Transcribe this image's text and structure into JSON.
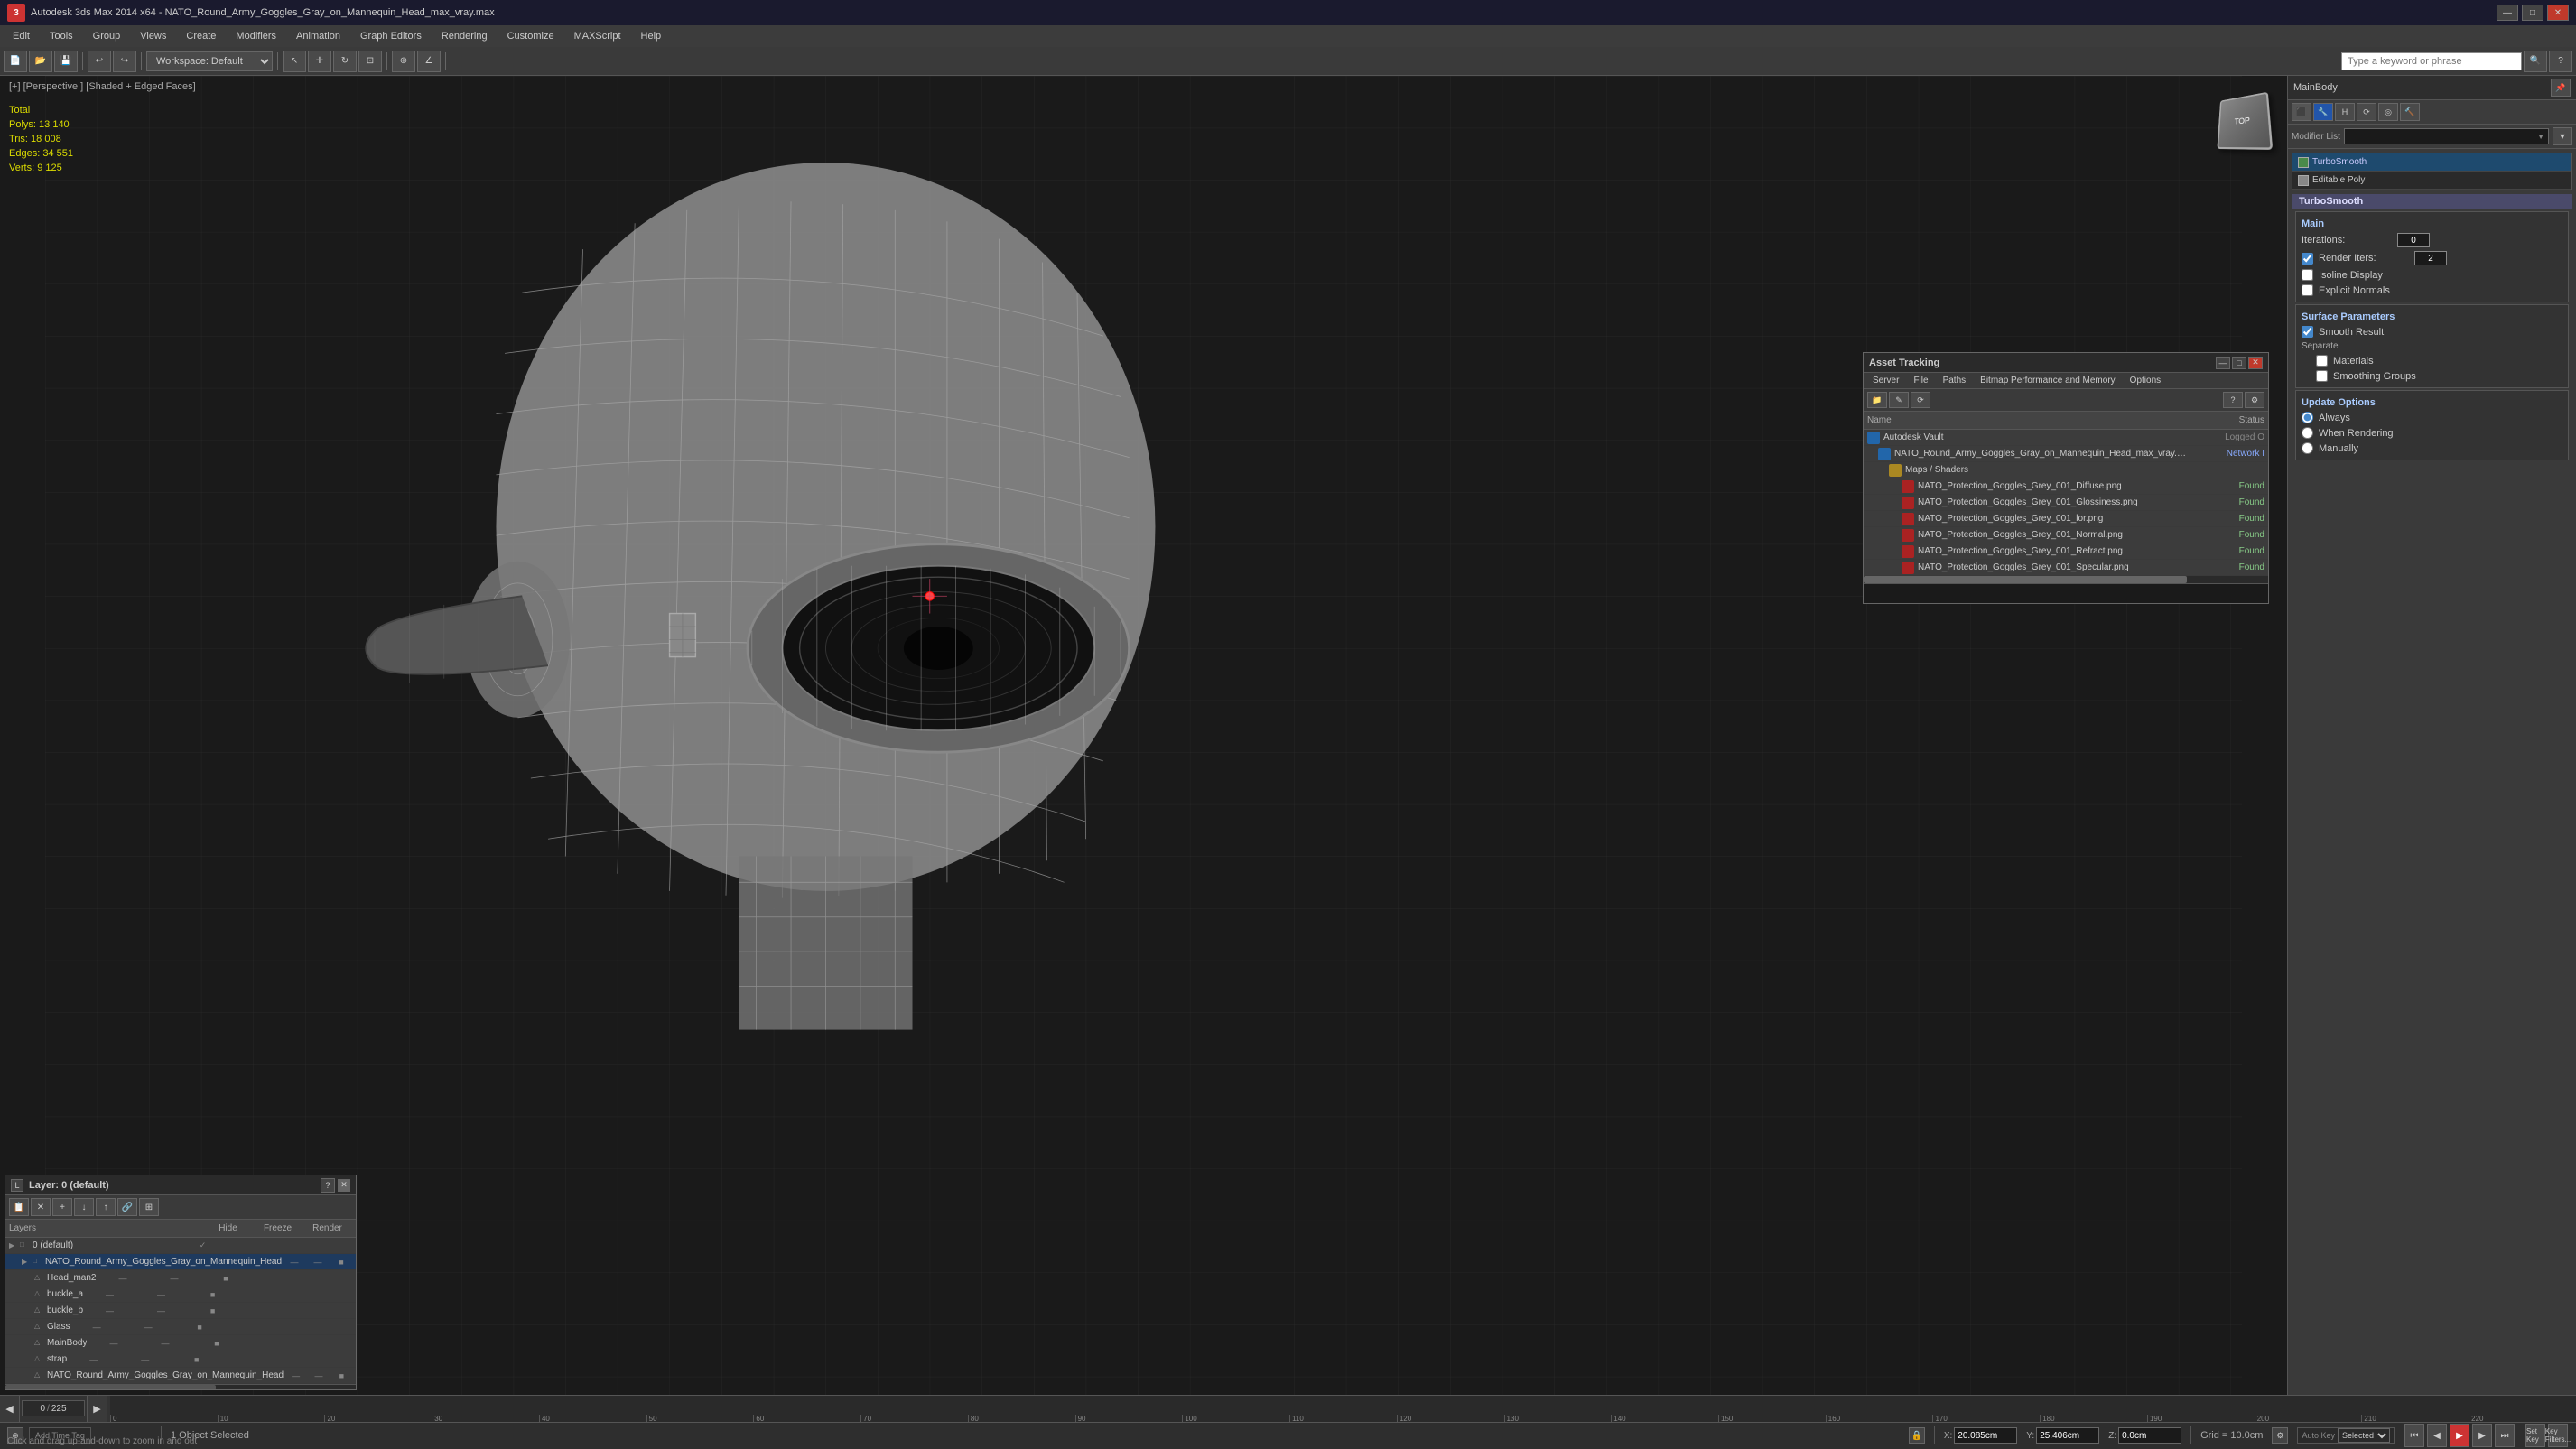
{
  "titlebar": {
    "title": "Autodesk 3ds Max  2014 x64    -    NATO_Round_Army_Goggles_Gray_on_Mannequin_Head_max_vray.max",
    "minimize": "—",
    "maximize": "□",
    "close": "✕"
  },
  "menu": {
    "items": [
      "Edit",
      "Tools",
      "Group",
      "Views",
      "Create",
      "Modifiers",
      "Animation",
      "Graph Editors",
      "Rendering",
      "Customize",
      "MAXScript",
      "Help"
    ]
  },
  "toolbar": {
    "workspace_label": "Workspace: Default",
    "search_placeholder": "Type a keyword or phrase"
  },
  "viewport": {
    "label": "[+] [Perspective ] [Shaded + Edged Faces]",
    "stats": {
      "polys_label": "Polys:",
      "polys_value": "13 140",
      "tris_label": "Tris:",
      "tris_value": "18 008",
      "edges_label": "Edges:",
      "edges_value": "34 551",
      "verts_label": "Verts:",
      "verts_value": "9 125",
      "total_label": "Total"
    }
  },
  "right_panel": {
    "object_name": "MainBody",
    "modifier_list_label": "Modifier List",
    "modifiers": [
      {
        "name": "TurboSmooth",
        "active": true
      },
      {
        "name": "Editable Poly",
        "active": false
      }
    ],
    "turbosmooth": {
      "section_title": "TurboSmooth",
      "main_label": "Main",
      "iterations_label": "Iterations:",
      "iterations_value": "0",
      "render_iters_label": "Render Iters:",
      "render_iters_value": "2",
      "isoline_label": "Isoline Display",
      "explicit_normals_label": "Explicit Normals",
      "surface_params_label": "Surface Parameters",
      "smooth_result_label": "Smooth Result",
      "separate_label": "Separate",
      "materials_label": "Materials",
      "smoothing_groups_label": "Smoothing Groups",
      "update_options_label": "Update Options",
      "always_label": "Always",
      "when_rendering_label": "When Rendering",
      "manually_label": "Manually"
    }
  },
  "layers_panel": {
    "title": "Layer: 0 (default)",
    "help_btn": "?",
    "columns": {
      "name": "Layers",
      "hide": "Hide",
      "freeze": "Freeze",
      "render": "Render"
    },
    "items": [
      {
        "indent": 0,
        "name": "0 (default)",
        "type": "layer",
        "selected": false,
        "checkmark": true
      },
      {
        "indent": 1,
        "name": "NATO_Round_Army_Goggles_Gray_on_Mannequin_Head",
        "type": "object",
        "selected": true
      },
      {
        "indent": 2,
        "name": "Head_man2",
        "type": "mesh"
      },
      {
        "indent": 2,
        "name": "buckle_a",
        "type": "mesh"
      },
      {
        "indent": 2,
        "name": "buckle_b",
        "type": "mesh"
      },
      {
        "indent": 2,
        "name": "Glass",
        "type": "mesh"
      },
      {
        "indent": 2,
        "name": "MainBody",
        "type": "mesh"
      },
      {
        "indent": 2,
        "name": "strap",
        "type": "mesh"
      },
      {
        "indent": 2,
        "name": "NATO_Round_Army_Goggles_Gray_on_Mannequin_Head",
        "type": "object2"
      }
    ]
  },
  "asset_panel": {
    "title": "Asset Tracking",
    "menus": [
      "Server",
      "File",
      "Paths",
      "Bitmap Performance and Memory",
      "Options"
    ],
    "columns": {
      "name": "Name",
      "status": "Status"
    },
    "items": [
      {
        "indent": 0,
        "icon": "blue",
        "name": "Autodesk Vault",
        "status": "Logged O",
        "status_type": "logged"
      },
      {
        "indent": 1,
        "icon": "blue",
        "name": "NATO_Round_Army_Goggles_Gray_on_Mannequin_Head_max_vray.max",
        "status": "Network I",
        "status_type": "network"
      },
      {
        "indent": 2,
        "icon": "yellow",
        "name": "Maps / Shaders",
        "status": "",
        "status_type": ""
      },
      {
        "indent": 3,
        "icon": "red",
        "name": "NATO_Protection_Goggles_Grey_001_Diffuse.png",
        "status": "Found",
        "status_type": "found"
      },
      {
        "indent": 3,
        "icon": "red",
        "name": "NATO_Protection_Goggles_Grey_001_Glossiness.png",
        "status": "Found",
        "status_type": "found"
      },
      {
        "indent": 3,
        "icon": "red",
        "name": "NATO_Protection_Goggles_Grey_001_lor.png",
        "status": "Found",
        "status_type": "found"
      },
      {
        "indent": 3,
        "icon": "red",
        "name": "NATO_Protection_Goggles_Grey_001_Normal.png",
        "status": "Found",
        "status_type": "found"
      },
      {
        "indent": 3,
        "icon": "red",
        "name": "NATO_Protection_Goggles_Grey_001_Refract.png",
        "status": "Found",
        "status_type": "found"
      },
      {
        "indent": 3,
        "icon": "red",
        "name": "NATO_Protection_Goggles_Grey_001_Specular.png",
        "status": "Found",
        "status_type": "found"
      }
    ]
  },
  "status_bar": {
    "frame_current": "0",
    "frame_total": "225",
    "selected_text": "1 Object Selected",
    "hint_text": "Click and drag up-and-down to zoom in and out",
    "x_label": "X:",
    "x_value": "20.085cm",
    "y_label": "Y:",
    "y_value": "25.406cm",
    "z_label": "Z:",
    "z_value": "0.0cm",
    "grid_label": "Grid = 10.0cm",
    "autokey_label": "Auto Key",
    "time_dropdown": "Selected"
  },
  "timeline": {
    "marks": [
      "0",
      "10",
      "20",
      "30",
      "40",
      "50",
      "60",
      "70",
      "80",
      "90",
      "100",
      "110",
      "120",
      "130",
      "140",
      "150",
      "160",
      "170",
      "180",
      "190",
      "200",
      "210",
      "220"
    ]
  }
}
